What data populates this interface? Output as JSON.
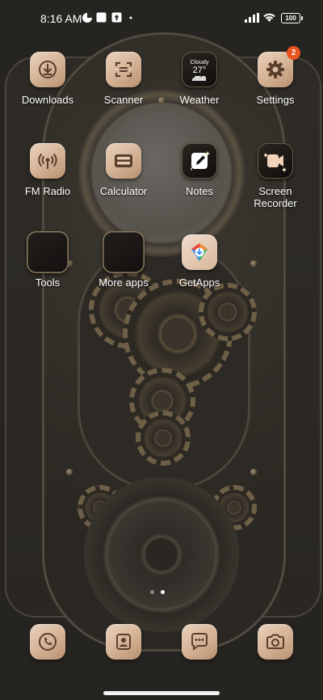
{
  "status_bar": {
    "time": "8:16 AM",
    "battery": "100",
    "left_icons": [
      "data-saver-icon",
      "notification-square-icon",
      "upload-arrow-icon",
      "dot-icon"
    ],
    "right_icons": [
      "signal-bars-icon",
      "wifi-icon",
      "battery-icon"
    ]
  },
  "apps": {
    "downloads": {
      "label": "Downloads",
      "icon": "download-icon"
    },
    "scanner": {
      "label": "Scanner",
      "icon": "scanner-icon"
    },
    "weather": {
      "label": "Weather",
      "icon": "weather-icon",
      "condition": "Cloudy",
      "temperature": "27°"
    },
    "settings": {
      "label": "Settings",
      "icon": "gear-icon",
      "badge": "2"
    },
    "fm_radio": {
      "label": "FM Radio",
      "icon": "radio-icon"
    },
    "calculator": {
      "label": "Calculator",
      "icon": "calculator-icon"
    },
    "notes": {
      "label": "Notes",
      "icon": "pencil-icon"
    },
    "screen_recorder": {
      "label": "Screen Recorder",
      "icon": "video-camera-icon"
    },
    "tools": {
      "label": "Tools",
      "icon": "folder-icon"
    },
    "more_apps": {
      "label": "More apps",
      "icon": "folder-icon"
    },
    "getapps": {
      "label": "GetApps",
      "icon": "getapps-icon"
    }
  },
  "dock": [
    {
      "name": "phone",
      "icon": "phone-icon"
    },
    {
      "name": "contacts",
      "icon": "contacts-icon"
    },
    {
      "name": "messages",
      "icon": "chat-bubble-icon"
    },
    {
      "name": "camera",
      "icon": "camera-icon"
    }
  ],
  "pages": {
    "count": 2,
    "active": 2
  },
  "colors": {
    "icon_tile": "#d9b99e",
    "badge": "#e8531f",
    "glyph": "#5a3f2c"
  }
}
